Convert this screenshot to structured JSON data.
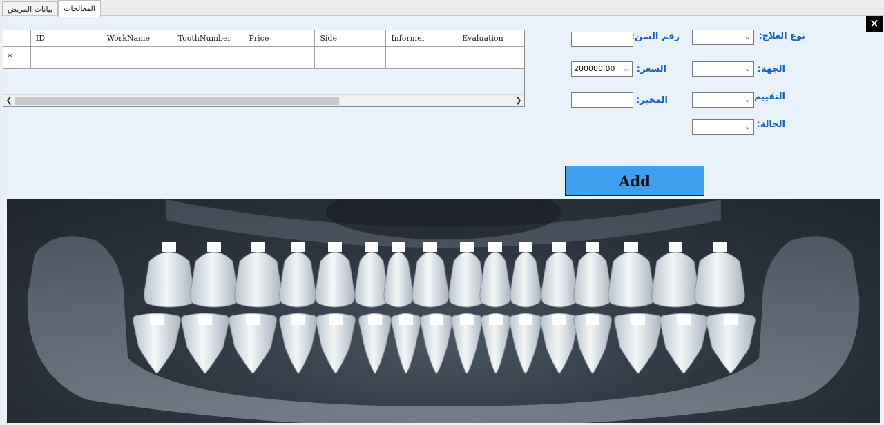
{
  "tabs": [
    {
      "label": "المعالجات",
      "active": true
    },
    {
      "label": "بيانات المريض",
      "active": false
    }
  ],
  "close_label": "✕",
  "grid": {
    "columns": [
      "ID",
      "WorkName",
      "ToothNumber",
      "Price",
      "Side",
      "Informer",
      "Evaluation"
    ],
    "new_row_marker": "*"
  },
  "form": {
    "treatment_type_label": "نوع العلاج:",
    "tooth_number_label": "رقم السن:",
    "side_label": "الجهة:",
    "price_label": "السعر:",
    "price_value": "200000.00",
    "evaluation_label": "التقييم:",
    "informer_label": "المخبر:",
    "status_label": "الحالة:"
  },
  "add_button": "Add",
  "teeth": {
    "upper_marks": [
      ".",
      ".",
      ".",
      ".",
      ".",
      ".",
      ".",
      ".",
      ".",
      ".",
      ".",
      ".",
      ".",
      ".",
      ".",
      "."
    ],
    "lower_marks": [
      ".",
      ".",
      ".",
      ".",
      ".",
      ".",
      ".",
      ".",
      ".",
      ".",
      ".",
      ".",
      ".",
      ".",
      ".",
      "."
    ]
  },
  "colors": {
    "panel_bg": "#e9f1fa",
    "label_blue": "#1a5fbf",
    "add_button_bg": "#3fa0f0"
  }
}
